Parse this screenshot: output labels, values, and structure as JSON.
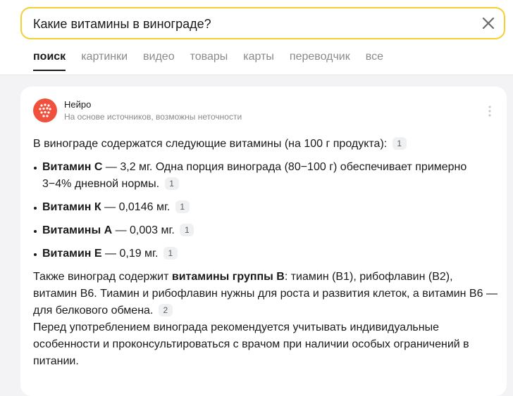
{
  "search": {
    "query": "Какие витамины в винограде?",
    "clear_icon": "close-icon"
  },
  "tabs": [
    {
      "label": "поиск",
      "active": true
    },
    {
      "label": "картинки",
      "active": false
    },
    {
      "label": "видео",
      "active": false
    },
    {
      "label": "товары",
      "active": false
    },
    {
      "label": "карты",
      "active": false
    },
    {
      "label": "переводчик",
      "active": false
    },
    {
      "label": "все",
      "active": false
    }
  ],
  "neuro": {
    "name": "Нейро",
    "subtitle": "На основе источников, возможны неточности",
    "logo_color": "#f0503c"
  },
  "answer": {
    "intro": "В винограде содержатся следующие витамины (на 100 г продукта):",
    "intro_cite": "1",
    "items": [
      {
        "name": "Витамин C",
        "text": " — 3,2 мг. Одна порция винограда (80−100 г) обеспечивает примерно 3−4% дневной нормы.",
        "cite": "1"
      },
      {
        "name": "Витамин К",
        "text": " — 0,0146 мг.",
        "cite": "1"
      },
      {
        "name": "Витамины А",
        "text": " — 0,003 мг.",
        "cite": "1"
      },
      {
        "name": "Витамин Е",
        "text": " — 0,19 мг.",
        "cite": "1"
      }
    ],
    "para2_before": "Также виноград содержит ",
    "para2_bold": "витамины группы B",
    "para2_after": ": тиамин (B1), рибофлавин (B2), витамин B6. Тиамин и рибофлавин нужны для роста и развития клеток, а витамин B6 — для белкового обмена.",
    "para2_cite": "2",
    "para3": "Перед употреблением винограда рекомендуется учитывать индивидуальные особенности и проконсультироваться с врачом при наличии особых ограничений в питании."
  },
  "colors": {
    "search_border": "#f5cf33",
    "background": "#f3f3f5",
    "muted_text": "#8a8a8f"
  }
}
